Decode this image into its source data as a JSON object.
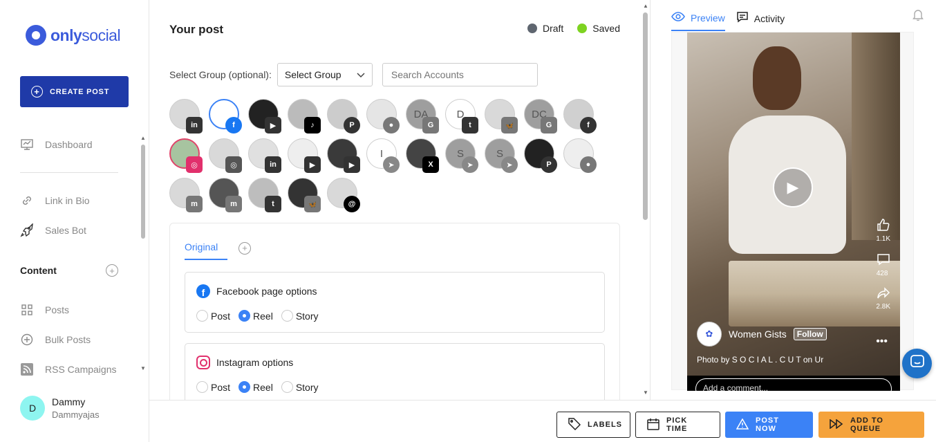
{
  "brand": {
    "name_bold": "only",
    "name_light": "social"
  },
  "sidebar": {
    "create_label": "CREATE POST",
    "items": [
      {
        "label": "Dashboard",
        "icon": "dashboard-icon"
      },
      {
        "label": "Link in Bio",
        "icon": "link-icon"
      },
      {
        "label": "Sales Bot",
        "icon": "rocket-icon"
      }
    ],
    "content_heading": "Content",
    "content_items": [
      {
        "label": "Posts",
        "icon": "grid-icon"
      },
      {
        "label": "Bulk Posts",
        "icon": "plus-circle-icon"
      },
      {
        "label": "RSS Campaigns",
        "icon": "rss-icon"
      }
    ],
    "user": {
      "initial": "D",
      "name": "Dammy",
      "handle": "Dammyajas"
    }
  },
  "post": {
    "title": "Your post",
    "status": [
      {
        "label": "Draft",
        "color": "#5f6670"
      },
      {
        "label": "Saved",
        "color": "#7ed321"
      }
    ],
    "group_label": "Select Group (optional):",
    "group_select": "Select Group",
    "search_placeholder": "Search Accounts",
    "accounts": [
      {
        "initial": "",
        "network": "linkedin",
        "badge": "in",
        "badge_color": "#333333",
        "avatar_bg": "#d9d9d9",
        "selected": ""
      },
      {
        "initial": "",
        "network": "facebook",
        "badge": "f",
        "badge_color": "#1877f2",
        "avatar_bg": "#ffffff",
        "selected": "blue"
      },
      {
        "initial": "",
        "network": "youtube",
        "badge": "▶",
        "badge_color": "#333333",
        "avatar_bg": "#222222",
        "selected": ""
      },
      {
        "initial": "",
        "network": "tiktok",
        "badge": "♪",
        "badge_color": "#000000",
        "avatar_bg": "#bbbbbb",
        "selected": ""
      },
      {
        "initial": "",
        "network": "pinterest",
        "badge": "P",
        "badge_color": "#333333",
        "avatar_bg": "#cccccc",
        "selected": ""
      },
      {
        "initial": "",
        "network": "reddit",
        "badge": "●",
        "badge_color": "#777777",
        "avatar_bg": "#e5e5e5",
        "selected": ""
      },
      {
        "initial": "DA",
        "network": "google",
        "badge": "G",
        "badge_color": "#777777",
        "avatar_bg": "#9e9e9e",
        "selected": ""
      },
      {
        "initial": "D",
        "network": "tumblr",
        "badge": "t",
        "badge_color": "#333333",
        "avatar_bg": "#ffffff",
        "selected": ""
      },
      {
        "initial": "",
        "network": "bluesky",
        "badge": "🦋",
        "badge_color": "#777777",
        "avatar_bg": "#d9d9d9",
        "selected": ""
      },
      {
        "initial": "DC",
        "network": "google",
        "badge": "G",
        "badge_color": "#777777",
        "avatar_bg": "#9e9e9e",
        "selected": ""
      },
      {
        "initial": "",
        "network": "facebook",
        "badge": "f",
        "badge_color": "#333333",
        "avatar_bg": "#d0d0d0",
        "selected": ""
      },
      {
        "initial": "",
        "network": "instagram",
        "badge": "◎",
        "badge_color": "#e1306c",
        "avatar_bg": "#a7c4a0",
        "selected": "red"
      },
      {
        "initial": "",
        "network": "instagram",
        "badge": "◎",
        "badge_color": "#555555",
        "avatar_bg": "#d9d9d9",
        "selected": ""
      },
      {
        "initial": "",
        "network": "linkedin",
        "badge": "in",
        "badge_color": "#333333",
        "avatar_bg": "#e0e0e0",
        "selected": ""
      },
      {
        "initial": "",
        "network": "youtube",
        "badge": "▶",
        "badge_color": "#333333",
        "avatar_bg": "#eeeeee",
        "selected": ""
      },
      {
        "initial": "",
        "network": "youtube",
        "badge": "▶",
        "badge_color": "#333333",
        "avatar_bg": "#3a3a3a",
        "selected": ""
      },
      {
        "initial": "I",
        "network": "telegram",
        "badge": "➤",
        "badge_color": "#888888",
        "avatar_bg": "#ffffff",
        "selected": ""
      },
      {
        "initial": "",
        "network": "x",
        "badge": "X",
        "badge_color": "#000000",
        "avatar_bg": "#444444",
        "selected": ""
      },
      {
        "initial": "S",
        "network": "telegram",
        "badge": "➤",
        "badge_color": "#888888",
        "avatar_bg": "#9e9e9e",
        "selected": ""
      },
      {
        "initial": "S",
        "network": "telegram",
        "badge": "➤",
        "badge_color": "#888888",
        "avatar_bg": "#9e9e9e",
        "selected": ""
      },
      {
        "initial": "",
        "network": "pinterest",
        "badge": "P",
        "badge_color": "#333333",
        "avatar_bg": "#222222",
        "selected": ""
      },
      {
        "initial": "",
        "network": "reddit",
        "badge": "●",
        "badge_color": "#777777",
        "avatar_bg": "#eeeeee",
        "selected": ""
      },
      {
        "initial": "",
        "network": "mastodon",
        "badge": "m",
        "badge_color": "#777777",
        "avatar_bg": "#d9d9d9",
        "selected": ""
      },
      {
        "initial": "",
        "network": "mastodon",
        "badge": "m",
        "badge_color": "#777777",
        "avatar_bg": "#555555",
        "selected": ""
      },
      {
        "initial": "",
        "network": "tumblr",
        "badge": "t",
        "badge_color": "#333333",
        "avatar_bg": "#bdbdbd",
        "selected": ""
      },
      {
        "initial": "",
        "network": "bluesky",
        "badge": "🦋",
        "badge_color": "#777777",
        "avatar_bg": "#333333",
        "selected": ""
      },
      {
        "initial": "",
        "network": "threads",
        "badge": "@",
        "badge_color": "#000000",
        "avatar_bg": "#d9d9d9",
        "selected": ""
      }
    ],
    "tabs": {
      "original": "Original"
    },
    "facebook_options": {
      "title": "Facebook page options",
      "choices": [
        {
          "label": "Post",
          "checked": false
        },
        {
          "label": "Reel",
          "checked": true
        },
        {
          "label": "Story",
          "checked": false
        }
      ]
    },
    "instagram_options": {
      "title": "Instagram options",
      "choices": [
        {
          "label": "Post",
          "checked": false
        },
        {
          "label": "Reel",
          "checked": true
        },
        {
          "label": "Story",
          "checked": false
        }
      ]
    }
  },
  "preview": {
    "tab_preview": "Preview",
    "tab_activity": "Activity",
    "likes": "1.1K",
    "comments": "428",
    "shares": "2.8K",
    "page_name": "Women Gists",
    "follow": "Follow",
    "caption": "Photo by S O C I A L . C U T on Ur",
    "comment_placeholder": "Add a comment..."
  },
  "actions": {
    "labels": "LABELS",
    "pick_time": "PICK TIME",
    "post_now": "POST NOW",
    "add_to_queue": "ADD TO QUEUE"
  }
}
